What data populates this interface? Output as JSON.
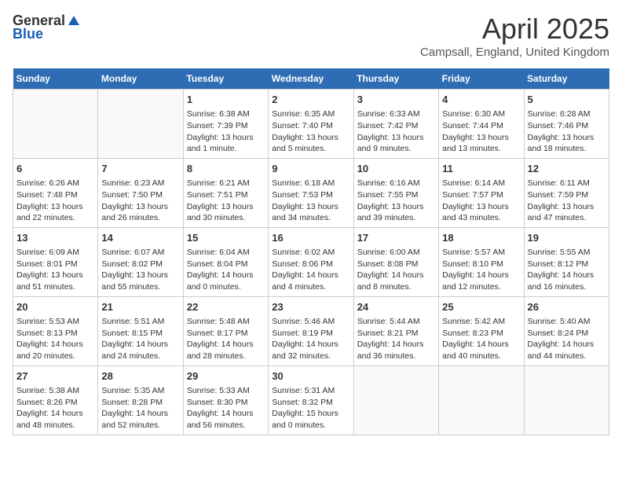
{
  "logo": {
    "general": "General",
    "blue": "Blue"
  },
  "title": "April 2025",
  "subtitle": "Campsall, England, United Kingdom",
  "days_of_week": [
    "Sunday",
    "Monday",
    "Tuesday",
    "Wednesday",
    "Thursday",
    "Friday",
    "Saturday"
  ],
  "weeks": [
    [
      {
        "day": "",
        "content": ""
      },
      {
        "day": "",
        "content": ""
      },
      {
        "day": "1",
        "content": "Sunrise: 6:38 AM\nSunset: 7:39 PM\nDaylight: 13 hours and 1 minute."
      },
      {
        "day": "2",
        "content": "Sunrise: 6:35 AM\nSunset: 7:40 PM\nDaylight: 13 hours and 5 minutes."
      },
      {
        "day": "3",
        "content": "Sunrise: 6:33 AM\nSunset: 7:42 PM\nDaylight: 13 hours and 9 minutes."
      },
      {
        "day": "4",
        "content": "Sunrise: 6:30 AM\nSunset: 7:44 PM\nDaylight: 13 hours and 13 minutes."
      },
      {
        "day": "5",
        "content": "Sunrise: 6:28 AM\nSunset: 7:46 PM\nDaylight: 13 hours and 18 minutes."
      }
    ],
    [
      {
        "day": "6",
        "content": "Sunrise: 6:26 AM\nSunset: 7:48 PM\nDaylight: 13 hours and 22 minutes."
      },
      {
        "day": "7",
        "content": "Sunrise: 6:23 AM\nSunset: 7:50 PM\nDaylight: 13 hours and 26 minutes."
      },
      {
        "day": "8",
        "content": "Sunrise: 6:21 AM\nSunset: 7:51 PM\nDaylight: 13 hours and 30 minutes."
      },
      {
        "day": "9",
        "content": "Sunrise: 6:18 AM\nSunset: 7:53 PM\nDaylight: 13 hours and 34 minutes."
      },
      {
        "day": "10",
        "content": "Sunrise: 6:16 AM\nSunset: 7:55 PM\nDaylight: 13 hours and 39 minutes."
      },
      {
        "day": "11",
        "content": "Sunrise: 6:14 AM\nSunset: 7:57 PM\nDaylight: 13 hours and 43 minutes."
      },
      {
        "day": "12",
        "content": "Sunrise: 6:11 AM\nSunset: 7:59 PM\nDaylight: 13 hours and 47 minutes."
      }
    ],
    [
      {
        "day": "13",
        "content": "Sunrise: 6:09 AM\nSunset: 8:01 PM\nDaylight: 13 hours and 51 minutes."
      },
      {
        "day": "14",
        "content": "Sunrise: 6:07 AM\nSunset: 8:02 PM\nDaylight: 13 hours and 55 minutes."
      },
      {
        "day": "15",
        "content": "Sunrise: 6:04 AM\nSunset: 8:04 PM\nDaylight: 14 hours and 0 minutes."
      },
      {
        "day": "16",
        "content": "Sunrise: 6:02 AM\nSunset: 8:06 PM\nDaylight: 14 hours and 4 minutes."
      },
      {
        "day": "17",
        "content": "Sunrise: 6:00 AM\nSunset: 8:08 PM\nDaylight: 14 hours and 8 minutes."
      },
      {
        "day": "18",
        "content": "Sunrise: 5:57 AM\nSunset: 8:10 PM\nDaylight: 14 hours and 12 minutes."
      },
      {
        "day": "19",
        "content": "Sunrise: 5:55 AM\nSunset: 8:12 PM\nDaylight: 14 hours and 16 minutes."
      }
    ],
    [
      {
        "day": "20",
        "content": "Sunrise: 5:53 AM\nSunset: 8:13 PM\nDaylight: 14 hours and 20 minutes."
      },
      {
        "day": "21",
        "content": "Sunrise: 5:51 AM\nSunset: 8:15 PM\nDaylight: 14 hours and 24 minutes."
      },
      {
        "day": "22",
        "content": "Sunrise: 5:48 AM\nSunset: 8:17 PM\nDaylight: 14 hours and 28 minutes."
      },
      {
        "day": "23",
        "content": "Sunrise: 5:46 AM\nSunset: 8:19 PM\nDaylight: 14 hours and 32 minutes."
      },
      {
        "day": "24",
        "content": "Sunrise: 5:44 AM\nSunset: 8:21 PM\nDaylight: 14 hours and 36 minutes."
      },
      {
        "day": "25",
        "content": "Sunrise: 5:42 AM\nSunset: 8:23 PM\nDaylight: 14 hours and 40 minutes."
      },
      {
        "day": "26",
        "content": "Sunrise: 5:40 AM\nSunset: 8:24 PM\nDaylight: 14 hours and 44 minutes."
      }
    ],
    [
      {
        "day": "27",
        "content": "Sunrise: 5:38 AM\nSunset: 8:26 PM\nDaylight: 14 hours and 48 minutes."
      },
      {
        "day": "28",
        "content": "Sunrise: 5:35 AM\nSunset: 8:28 PM\nDaylight: 14 hours and 52 minutes."
      },
      {
        "day": "29",
        "content": "Sunrise: 5:33 AM\nSunset: 8:30 PM\nDaylight: 14 hours and 56 minutes."
      },
      {
        "day": "30",
        "content": "Sunrise: 5:31 AM\nSunset: 8:32 PM\nDaylight: 15 hours and 0 minutes."
      },
      {
        "day": "",
        "content": ""
      },
      {
        "day": "",
        "content": ""
      },
      {
        "day": "",
        "content": ""
      }
    ]
  ]
}
